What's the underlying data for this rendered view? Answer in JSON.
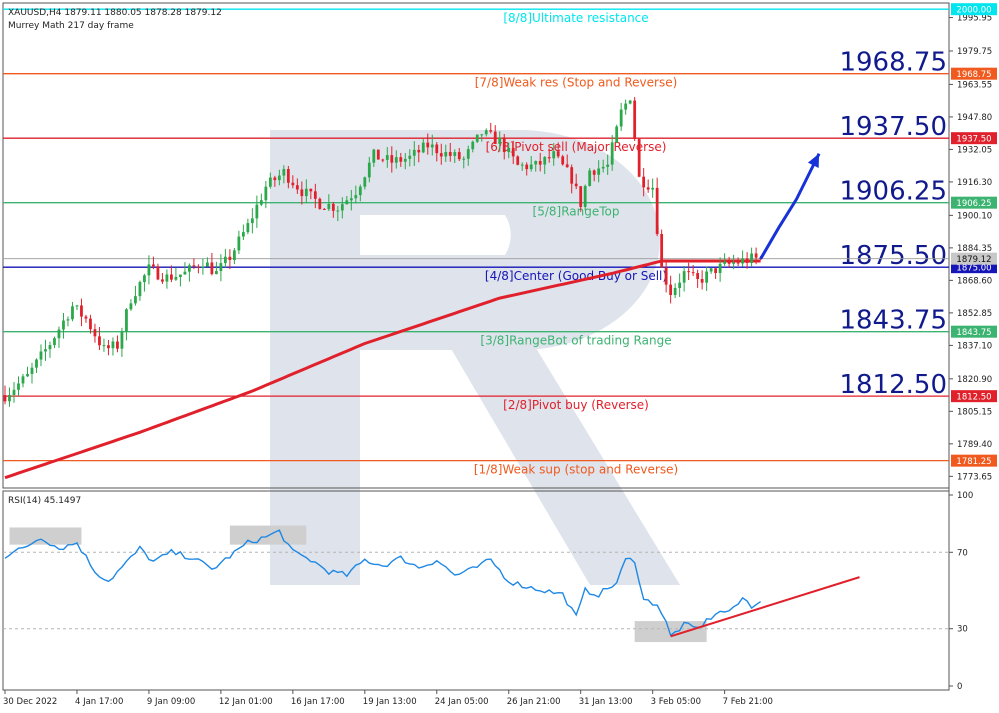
{
  "header": {
    "symbol_line": "XAUUSD,H4  1879.11 1880.05 1878.28 1879.12",
    "indicator_line": "Murrey Math 217 day frame"
  },
  "rsi_header": "RSI(14) 45.1497",
  "colors": {
    "background": "#ffffff",
    "bull_candle": "#2aa84a",
    "bear_candle": "#e0212b",
    "ma_line": "#e0212b",
    "rsi_line": "#1e88e5",
    "arrow": "#1732d8",
    "watermark": "#dfe3ec"
  },
  "chart_data": [
    {
      "type": "candlestick",
      "title": "XAUUSD,H4",
      "ylim": [
        1768.0,
        2003.0
      ],
      "y_ticks": [
        "1995.95",
        "1979.75",
        "1963.55",
        "1947.80",
        "1932.05",
        "1916.30",
        "1900.10",
        "1884.35",
        "1868.60",
        "1852.85",
        "1837.10",
        "1820.90",
        "1805.15",
        "1789.40",
        "1773.65"
      ],
      "x_ticks": [
        "30 Dec 2022",
        "4 Jan 17:00",
        "9 Jan 09:00",
        "12 Jan 01:00",
        "16 Jan 17:00",
        "19 Jan 13:00",
        "24 Jan 05:00",
        "26 Jan 21:00",
        "31 Jan 13:00",
        "3 Feb 05:00",
        "7 Feb 21:00"
      ],
      "current_price": "1879.12",
      "murrey_levels": [
        {
          "value": 2000.0,
          "tag": "2000.00",
          "label": "[8/8]Ultimate resistance",
          "big": "",
          "color": "#00e5ee"
        },
        {
          "value": 1968.75,
          "tag": "1968.75",
          "label": "[7/8]Weak res (Stop and Reverse)",
          "big": "1968.75",
          "color": "#f05a1e"
        },
        {
          "value": 1937.5,
          "tag": "1937.50",
          "label": "[6/8]Pivot sell (Major Reverse)",
          "big": "1937.50",
          "color": "#e0212b"
        },
        {
          "value": 1906.25,
          "tag": "1906.25",
          "label": "[5/8]RangeTop",
          "big": "1906.25",
          "color": "#3cb371"
        },
        {
          "value": 1875.0,
          "tag": "1875.00",
          "label": "[4/8]Center (Good Buy or Sell)",
          "big": "1875.50",
          "color": "#1515b8"
        },
        {
          "value": 1843.75,
          "tag": "1843.75",
          "label": "[3/8]RangeBot of trading Range",
          "big": "1843.75",
          "color": "#3cb371"
        },
        {
          "value": 1812.5,
          "tag": "1812.50",
          "label": "[2/8]Pivot buy (Reverse)",
          "big": "1812.50",
          "color": "#e0212b"
        },
        {
          "value": 1781.25,
          "tag": "1781.25",
          "label": "[1/8]Weak sup (stop and Reverse)",
          "big": "",
          "color": "#f05a1e"
        }
      ],
      "price_path": [
        {
          "i": 0,
          "p": 1813
        },
        {
          "i": 5,
          "p": 1822
        },
        {
          "i": 10,
          "p": 1838
        },
        {
          "i": 15,
          "p": 1856
        },
        {
          "i": 18,
          "p": 1850
        },
        {
          "i": 22,
          "p": 1835
        },
        {
          "i": 25,
          "p": 1837
        },
        {
          "i": 28,
          "p": 1860
        },
        {
          "i": 32,
          "p": 1874
        },
        {
          "i": 36,
          "p": 1870
        },
        {
          "i": 40,
          "p": 1872
        },
        {
          "i": 44,
          "p": 1878
        },
        {
          "i": 47,
          "p": 1872
        },
        {
          "i": 50,
          "p": 1880
        },
        {
          "i": 54,
          "p": 1895
        },
        {
          "i": 58,
          "p": 1914
        },
        {
          "i": 62,
          "p": 1921
        },
        {
          "i": 66,
          "p": 1912
        },
        {
          "i": 70,
          "p": 1906
        },
        {
          "i": 74,
          "p": 1904
        },
        {
          "i": 78,
          "p": 1912
        },
        {
          "i": 82,
          "p": 1929
        },
        {
          "i": 86,
          "p": 1926
        },
        {
          "i": 90,
          "p": 1928
        },
        {
          "i": 94,
          "p": 1934
        },
        {
          "i": 98,
          "p": 1930
        },
        {
          "i": 102,
          "p": 1927
        },
        {
          "i": 106,
          "p": 1940
        },
        {
          "i": 110,
          "p": 1936
        },
        {
          "i": 114,
          "p": 1924
        },
        {
          "i": 118,
          "p": 1924
        },
        {
          "i": 122,
          "p": 1929
        },
        {
          "i": 126,
          "p": 1918
        },
        {
          "i": 128,
          "p": 1906
        },
        {
          "i": 130,
          "p": 1922
        },
        {
          "i": 134,
          "p": 1924
        },
        {
          "i": 137,
          "p": 1950
        },
        {
          "i": 139,
          "p": 1958
        },
        {
          "i": 141,
          "p": 1918
        },
        {
          "i": 144,
          "p": 1914
        },
        {
          "i": 146,
          "p": 1874
        },
        {
          "i": 148,
          "p": 1863
        },
        {
          "i": 151,
          "p": 1872
        },
        {
          "i": 154,
          "p": 1868
        },
        {
          "i": 158,
          "p": 1874
        },
        {
          "i": 162,
          "p": 1877
        },
        {
          "i": 166,
          "p": 1879
        },
        {
          "i": 168,
          "p": 1879
        }
      ],
      "ma_path": [
        {
          "i": 0,
          "p": 1773
        },
        {
          "i": 30,
          "p": 1795
        },
        {
          "i": 55,
          "p": 1815
        },
        {
          "i": 80,
          "p": 1838
        },
        {
          "i": 110,
          "p": 1860
        },
        {
          "i": 135,
          "p": 1872
        },
        {
          "i": 146,
          "p": 1878
        },
        {
          "i": 168,
          "p": 1878
        }
      ],
      "projection": [
        {
          "i": 168,
          "p": 1879
        },
        {
          "i": 172,
          "p": 1894
        },
        {
          "i": 176,
          "p": 1908
        },
        {
          "i": 181,
          "p": 1930
        }
      ]
    },
    {
      "type": "line",
      "title": "RSI(14) 45.1497",
      "ylim": [
        0,
        100
      ],
      "y_ticks": [
        "100",
        "70",
        "30",
        "0"
      ],
      "series": [
        {
          "name": "RSI(14)",
          "points": [
            {
              "i": 0,
              "v": 68
            },
            {
              "i": 4,
              "v": 72
            },
            {
              "i": 8,
              "v": 78
            },
            {
              "i": 12,
              "v": 72
            },
            {
              "i": 16,
              "v": 75
            },
            {
              "i": 20,
              "v": 60
            },
            {
              "i": 23,
              "v": 55
            },
            {
              "i": 26,
              "v": 62
            },
            {
              "i": 30,
              "v": 72
            },
            {
              "i": 33,
              "v": 65
            },
            {
              "i": 37,
              "v": 70
            },
            {
              "i": 42,
              "v": 67
            },
            {
              "i": 46,
              "v": 61
            },
            {
              "i": 50,
              "v": 68
            },
            {
              "i": 54,
              "v": 75
            },
            {
              "i": 58,
              "v": 78
            },
            {
              "i": 61,
              "v": 81
            },
            {
              "i": 64,
              "v": 70
            },
            {
              "i": 68,
              "v": 66
            },
            {
              "i": 72,
              "v": 60
            },
            {
              "i": 76,
              "v": 58
            },
            {
              "i": 80,
              "v": 66
            },
            {
              "i": 84,
              "v": 63
            },
            {
              "i": 88,
              "v": 67
            },
            {
              "i": 92,
              "v": 62
            },
            {
              "i": 96,
              "v": 66
            },
            {
              "i": 100,
              "v": 58
            },
            {
              "i": 104,
              "v": 61
            },
            {
              "i": 108,
              "v": 66
            },
            {
              "i": 112,
              "v": 55
            },
            {
              "i": 116,
              "v": 52
            },
            {
              "i": 120,
              "v": 50
            },
            {
              "i": 124,
              "v": 48
            },
            {
              "i": 127,
              "v": 36
            },
            {
              "i": 129,
              "v": 50
            },
            {
              "i": 132,
              "v": 48
            },
            {
              "i": 136,
              "v": 54
            },
            {
              "i": 138,
              "v": 66
            },
            {
              "i": 140,
              "v": 66
            },
            {
              "i": 142,
              "v": 45
            },
            {
              "i": 145,
              "v": 43
            },
            {
              "i": 147,
              "v": 33
            },
            {
              "i": 148,
              "v": 26
            },
            {
              "i": 151,
              "v": 32
            },
            {
              "i": 154,
              "v": 30
            },
            {
              "i": 158,
              "v": 38
            },
            {
              "i": 162,
              "v": 40
            },
            {
              "i": 164,
              "v": 46
            },
            {
              "i": 166,
              "v": 42
            },
            {
              "i": 168,
              "v": 45.15
            }
          ]
        }
      ],
      "trendline": [
        {
          "i": 148,
          "v": 26
        },
        {
          "i": 190,
          "v": 57
        }
      ],
      "highlight_zones": [
        {
          "i0": 1,
          "i1": 17,
          "v0": 74,
          "v1": 83
        },
        {
          "i0": 50,
          "i1": 67,
          "v0": 74,
          "v1": 84
        },
        {
          "i0": 140,
          "i1": 156,
          "v0": 23,
          "v1": 34
        }
      ]
    }
  ]
}
